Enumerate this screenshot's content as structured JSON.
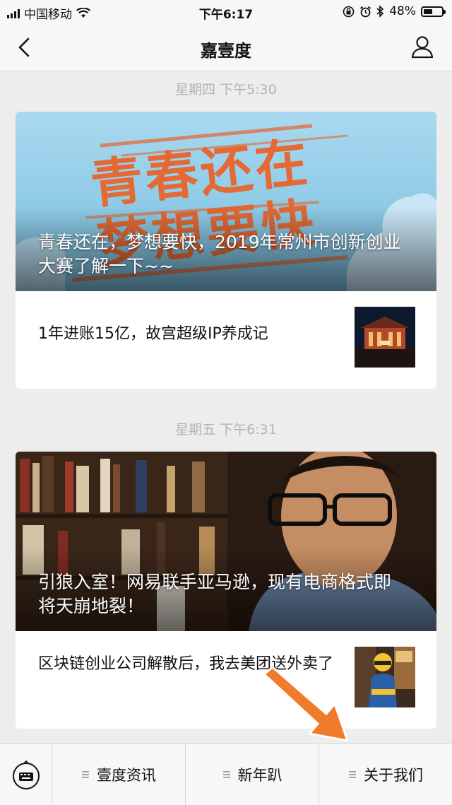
{
  "status_bar": {
    "carrier": "中国移动",
    "time": "下午6:17",
    "battery_text": "48%",
    "battery_level": 0.48
  },
  "nav": {
    "title": "嘉壹度",
    "icons": [
      "back-chevron-icon",
      "profile-icon"
    ]
  },
  "feed": [
    {
      "timestamp": "星期四 下午5:30",
      "hero_caption": "青春还在，梦想要快，2019年常州市创新创业大赛了解一下~~",
      "hero_art_text": "青春还在 梦想要快",
      "sub_title": "1年进账15亿，故宫超级IP养成记"
    },
    {
      "timestamp": "星期五 下午6:31",
      "hero_caption": "引狼入室！网易联手亚马逊，现有电商格式即将天崩地裂！",
      "sub_title": "区块链创业公司解散后，我去美团送外卖了"
    }
  ],
  "menu": {
    "items": [
      "壹度资讯",
      "新年趴",
      "关于我们"
    ],
    "keyboard_icon": "keyboard-icon"
  },
  "colors": {
    "background": "#ededed",
    "bar": "#f7f7f7",
    "timestamp": "#b3b3b3",
    "arrow": "#f07b2a"
  }
}
